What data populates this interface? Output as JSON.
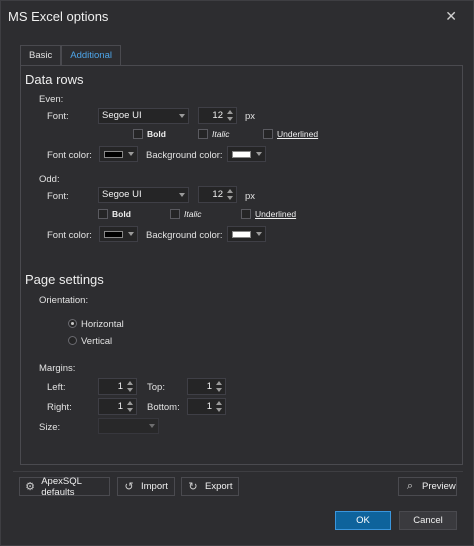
{
  "window": {
    "title": "MS Excel options"
  },
  "tabs": [
    {
      "label": "Basic",
      "active": false
    },
    {
      "label": "Additional",
      "active": true
    }
  ],
  "data_rows": {
    "section_title": "Data rows",
    "even": {
      "group_label": "Even:",
      "font_label": "Font:",
      "font_value": "Segoe UI",
      "size_value": "12",
      "unit": "px",
      "bold_label": "Bold",
      "italic_label": "Italic",
      "underlined_label": "Underlined",
      "font_color_label": "Font color:",
      "font_color": "#000000",
      "background_color_label": "Background color:",
      "background_color": "#ffffff"
    },
    "odd": {
      "group_label": "Odd:",
      "font_label": "Font:",
      "font_value": "Segoe UI",
      "size_value": "12",
      "unit": "px",
      "bold_label": "Bold",
      "italic_label": "Italic",
      "underlined_label": "Underlined",
      "font_color_label": "Font color:",
      "font_color": "#000000",
      "background_color_label": "Background color:",
      "background_color": "#ffffff"
    }
  },
  "page_settings": {
    "section_title": "Page settings",
    "orientation_label": "Orientation:",
    "horizontal_label": "Horizontal",
    "vertical_label": "Vertical",
    "selected_orientation": "Horizontal",
    "margins_label": "Margins:",
    "left_label": "Left:",
    "left_value": "1",
    "top_label": "Top:",
    "top_value": "1",
    "right_label": "Right:",
    "right_value": "1",
    "bottom_label": "Bottom:",
    "bottom_value": "1",
    "size_label": "Size:",
    "size_value": ""
  },
  "footer": {
    "defaults_label": "ApexSQL defaults",
    "import_label": "Import",
    "export_label": "Export",
    "preview_label": "Preview",
    "ok_label": "OK",
    "cancel_label": "Cancel"
  },
  "colors": {
    "background": "#2d2d30",
    "accent": "#0e639c",
    "tab_active_text": "#4ea6ea"
  }
}
